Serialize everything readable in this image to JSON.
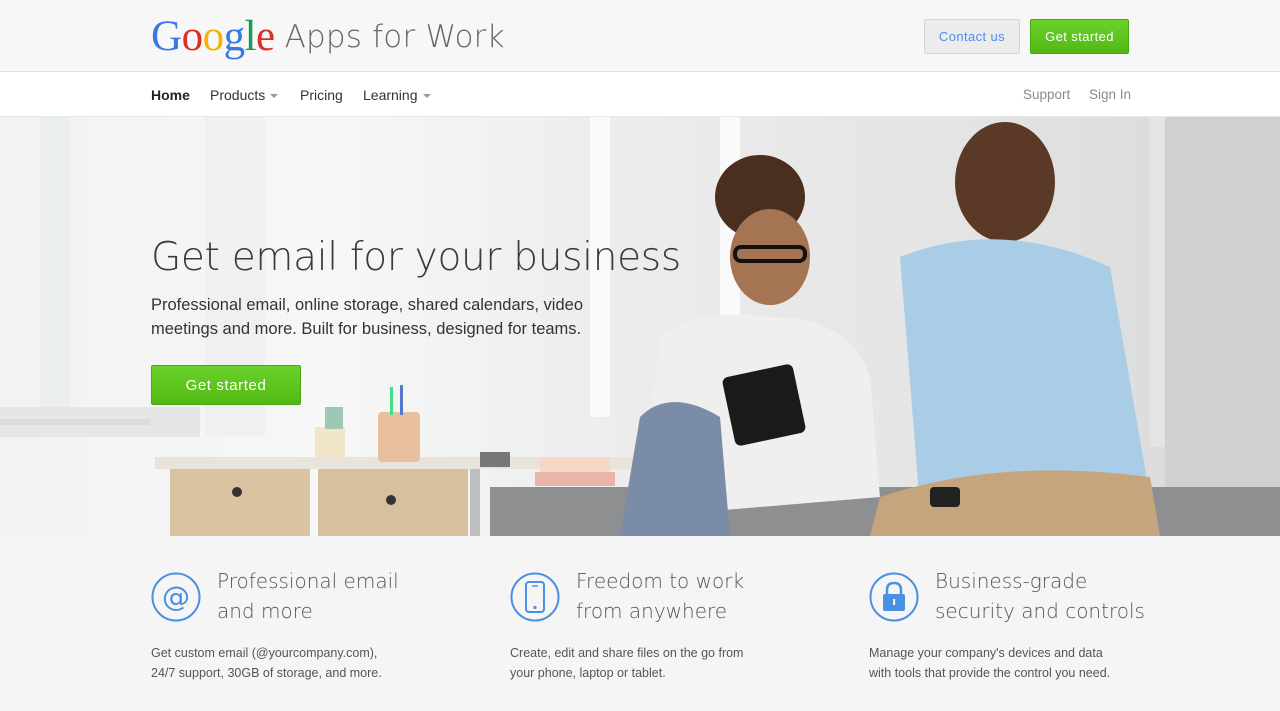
{
  "brand": {
    "google_letters": [
      {
        "char": "G",
        "color": "#3b78e7"
      },
      {
        "char": "o",
        "color": "#d93025"
      },
      {
        "char": "o",
        "color": "#f4b400"
      },
      {
        "char": "g",
        "color": "#3b78e7"
      },
      {
        "char": "l",
        "color": "#0f9d58"
      },
      {
        "char": "e",
        "color": "#d93025"
      }
    ],
    "suffix": "Apps for Work"
  },
  "header": {
    "contact_label": "Contact us",
    "get_started_label": "Get started"
  },
  "nav": {
    "items": [
      {
        "label": "Home",
        "active": true
      },
      {
        "label": "Products",
        "dropdown": true
      },
      {
        "label": "Pricing"
      },
      {
        "label": "Learning",
        "dropdown": true
      }
    ],
    "right": [
      "Support",
      "Sign In"
    ]
  },
  "hero": {
    "title": "Get email for your business",
    "subtitle": "Professional email, online storage, shared calendars, video meetings and more. Built for business, designed for teams.",
    "cta_label": "Get started"
  },
  "features": [
    {
      "icon": "at-sign-icon",
      "title": "Professional email\nand more",
      "description": "Get custom email (@yourcompany.com),\n24/7 support, 30GB of storage, and more."
    },
    {
      "icon": "smartphone-icon",
      "title": "Freedom to work\nfrom anywhere",
      "description": "Create, edit and share files on the go from\nyour phone, laptop or tablet."
    },
    {
      "icon": "lock-icon",
      "title": "Business-grade\nsecurity and controls",
      "description": "Manage your company's devices and data\nwith tools that provide the control you need."
    }
  ],
  "colors": {
    "accent_green": "#5cc21b",
    "link_blue": "#4a8ef0",
    "icon_blue": "#4a90e2"
  }
}
